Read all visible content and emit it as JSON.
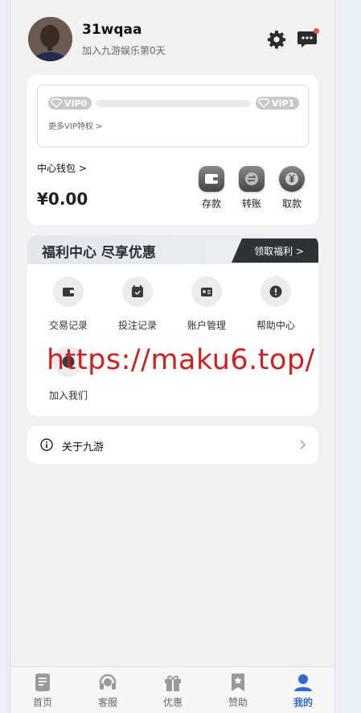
{
  "profile": {
    "username": "31wqaa",
    "joined_text": "加入九游娱乐第0天"
  },
  "icons": {
    "settings": "gear-icon",
    "messages": "chat-bubble-icon",
    "notification_dot_color": "#e5534b"
  },
  "vip": {
    "current_level": "VIP0",
    "next_level": "VIP1",
    "progress": 0,
    "more_label": "更多VIP特权 >"
  },
  "wallet": {
    "title": "中心钱包 >",
    "balance": "¥0.00",
    "actions": [
      {
        "label": "存款",
        "icon": "wallet-icon"
      },
      {
        "label": "转账",
        "icon": "transfer-icon"
      },
      {
        "label": "取款",
        "icon": "yuan-coin-icon"
      }
    ]
  },
  "welfare": {
    "title": "福利中心 尽享优惠",
    "claim_button": "领取福利 >",
    "items": [
      {
        "label": "交易记录",
        "icon": "wallet-record-icon"
      },
      {
        "label": "投注记录",
        "icon": "calendar-icon"
      },
      {
        "label": "账户管理",
        "icon": "id-card-icon"
      },
      {
        "label": "帮助中心",
        "icon": "exclamation-icon"
      },
      {
        "label": "加入我们",
        "icon": "join-icon"
      }
    ],
    "watermark": "https://maku6.top/"
  },
  "about": {
    "label": "关于九游"
  },
  "bottom_nav": [
    {
      "label": "首页",
      "icon": "document-icon",
      "active": false
    },
    {
      "label": "客服",
      "icon": "headset-icon",
      "active": false
    },
    {
      "label": "优惠",
      "icon": "gift-icon",
      "active": false
    },
    {
      "label": "赞助",
      "icon": "bookmark-star-icon",
      "active": false
    },
    {
      "label": "我的",
      "icon": "user-icon",
      "active": true
    }
  ],
  "colors": {
    "accent": "#2f6ad6",
    "watermark": "#d11f1f",
    "dark_button": "#2f3237"
  }
}
